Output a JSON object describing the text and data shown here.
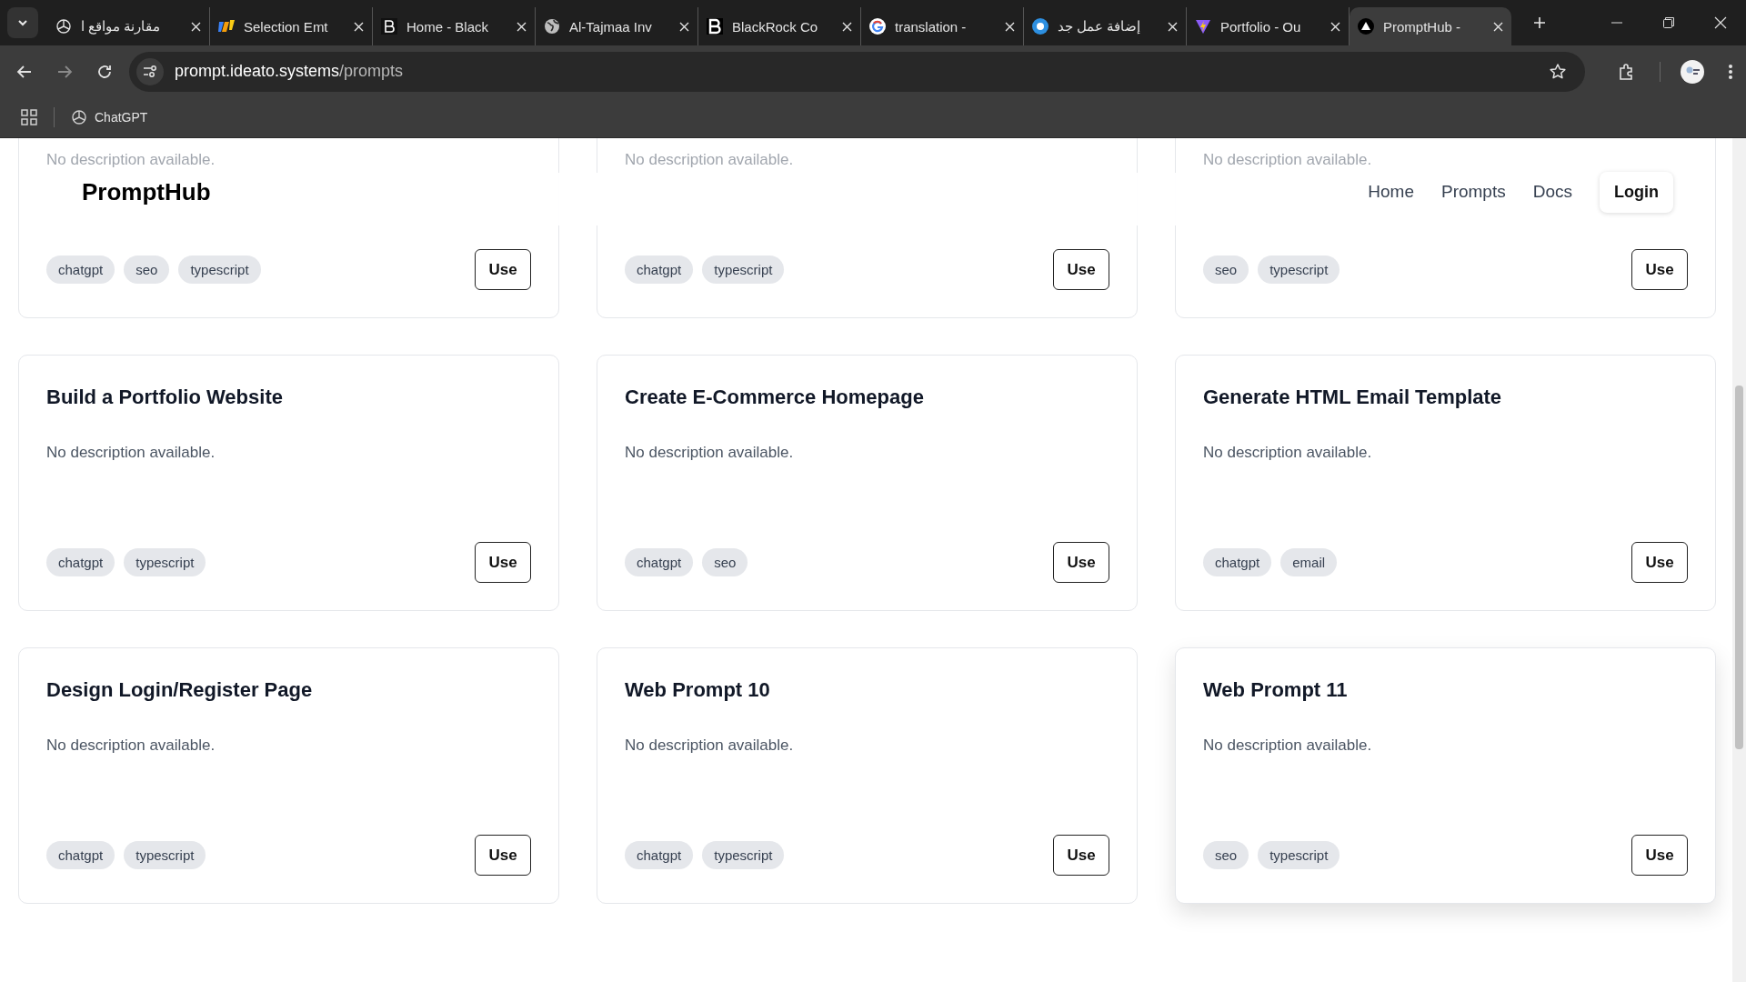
{
  "browser": {
    "tabs": [
      {
        "title": "مقارنة مواقع ا",
        "selected": false
      },
      {
        "title": "Selection Emt",
        "selected": false
      },
      {
        "title": "Home - Black",
        "selected": false
      },
      {
        "title": "Al-Tajmaa Inv",
        "selected": false
      },
      {
        "title": "BlackRock Co",
        "selected": false
      },
      {
        "title": "translation -",
        "selected": false
      },
      {
        "title": "إضافة عمل جد",
        "selected": false
      },
      {
        "title": "Portfolio - Ou",
        "selected": false
      },
      {
        "title": "PromptHub -",
        "selected": true
      }
    ],
    "address": {
      "host": "prompt.ideato.systems",
      "path": "/prompts"
    },
    "bookmarks": [
      {
        "label": "ChatGPT"
      }
    ]
  },
  "header": {
    "brand": "PromptHub",
    "nav": [
      {
        "label": "Home"
      },
      {
        "label": "Prompts"
      },
      {
        "label": "Docs"
      }
    ],
    "login": "Login"
  },
  "cards": [
    {
      "description": "No description available.",
      "tags": [
        "chatgpt",
        "seo",
        "typescript"
      ],
      "action": "Use",
      "elevated": false
    },
    {
      "description": "No description available.",
      "tags": [
        "chatgpt",
        "typescript"
      ],
      "action": "Use",
      "elevated": false
    },
    {
      "description": "No description available.",
      "tags": [
        "seo",
        "typescript"
      ],
      "action": "Use",
      "elevated": false
    },
    {
      "title": "Build a Portfolio Website",
      "description": "No description available.",
      "tags": [
        "chatgpt",
        "typescript"
      ],
      "action": "Use",
      "elevated": false
    },
    {
      "title": "Create E-Commerce Homepage",
      "description": "No description available.",
      "tags": [
        "chatgpt",
        "seo"
      ],
      "action": "Use",
      "elevated": false
    },
    {
      "title": "Generate HTML Email Template",
      "description": "No description available.",
      "tags": [
        "chatgpt",
        "email"
      ],
      "action": "Use",
      "elevated": false
    },
    {
      "title": "Design Login/Register Page",
      "description": "No description available.",
      "tags": [
        "chatgpt",
        "typescript"
      ],
      "action": "Use",
      "elevated": false
    },
    {
      "title": "Web Prompt 10",
      "description": "No description available.",
      "tags": [
        "chatgpt",
        "typescript"
      ],
      "action": "Use",
      "elevated": false
    },
    {
      "title": "Web Prompt 11",
      "description": "No description available.",
      "tags": [
        "seo",
        "typescript"
      ],
      "action": "Use",
      "elevated": true
    }
  ]
}
